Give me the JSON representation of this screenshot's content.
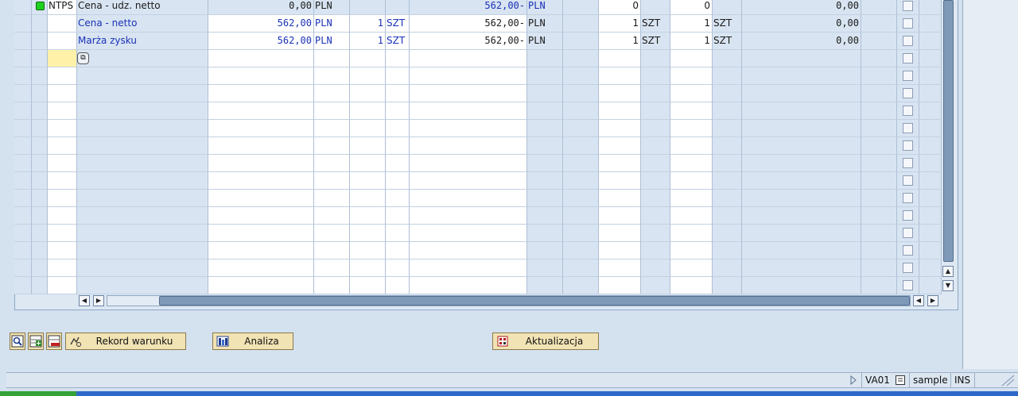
{
  "table": {
    "rows": [
      {
        "status": "green",
        "type": "NTPS",
        "name": "Cena - udz. netto",
        "amount": "0,00",
        "currency": "PLN",
        "per": "",
        "uom": "",
        "value": "562,00-",
        "value_currency": "PLN",
        "num1": "0",
        "num1_unit": "",
        "num2": "0",
        "num2_unit": "",
        "cond_value": "0,00",
        "selected": false,
        "name_style": "dark"
      },
      {
        "status": "",
        "type": "",
        "name": "Cena - netto",
        "amount": "562,00",
        "currency": "PLN",
        "per": "1",
        "uom": "SZT",
        "value": "562,00-",
        "value_currency": "PLN",
        "num1": "1",
        "num1_unit": "SZT",
        "num2": "1",
        "num2_unit": "SZT",
        "cond_value": "0,00",
        "selected": false,
        "name_style": "link"
      },
      {
        "status": "",
        "type": "",
        "name": "Marża zysku",
        "amount": "562,00",
        "currency": "PLN",
        "per": "1",
        "uom": "SZT",
        "value": "562,00-",
        "value_currency": "PLN",
        "num1": "1",
        "num1_unit": "SZT",
        "num2": "1",
        "num2_unit": "SZT",
        "cond_value": "0,00",
        "selected": false,
        "name_style": "link"
      }
    ],
    "empty_row_count": 14
  },
  "buttons": {
    "record": "Rekord warunku",
    "analysis": "Analiza",
    "update": "Aktualizacja"
  },
  "statusbar": {
    "transaction": "VA01",
    "system": "sample",
    "mode": "INS"
  },
  "colors": {
    "link": "#1a31b8",
    "status_ok": "#1fd11f",
    "button_bg": "#f1e3b4"
  },
  "icons": {
    "f4_help": "value-help-icon",
    "record_icon": "condition-record-icon",
    "analysis_icon": "analysis-icon",
    "update_icon": "update-pricing-icon",
    "details": "magnifier-details-icon",
    "insert_row": "insert-row-icon",
    "delete_row": "delete-row-icon"
  }
}
